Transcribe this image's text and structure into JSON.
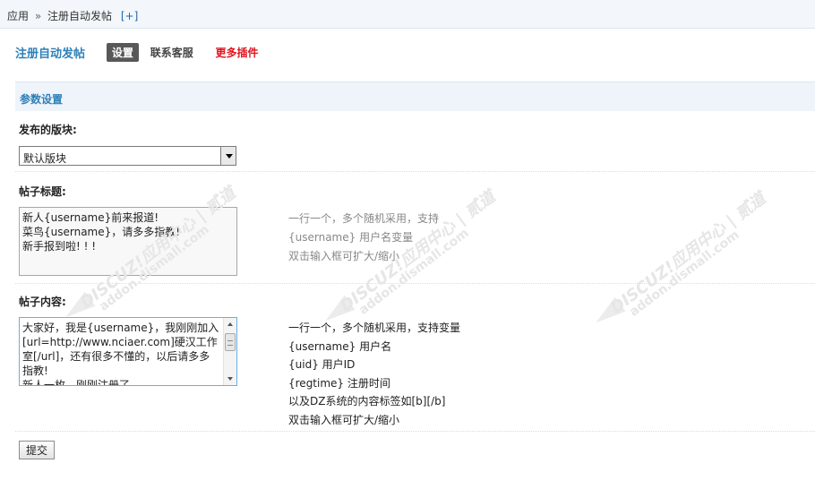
{
  "breadcrumb": {
    "app": "应用",
    "separator": "»",
    "current": "注册自动发帖",
    "add_label": "[+]"
  },
  "header": {
    "title": "注册自动发帖",
    "tabs": [
      {
        "label": "设置",
        "active": true
      },
      {
        "label": "联系客服",
        "active": false
      },
      {
        "label": "更多插件",
        "active": false,
        "color": "#e0141e"
      }
    ]
  },
  "section": {
    "title": "参数设置"
  },
  "form": {
    "forum": {
      "label": "发布的版块:",
      "selected": "默认版块"
    },
    "post_title": {
      "label": "帖子标题:",
      "lines": [
        "新人{username}前来报道!",
        "菜鸟{username}，请多多指教!",
        "新手报到啦! ! !"
      ],
      "tips": [
        "一行一个，多个随机采用，支持",
        "{username} 用户名变量",
        "双击输入框可扩大/缩小"
      ]
    },
    "post_content": {
      "label": "帖子内容:",
      "text": "大家好，我是{username}，我刚刚加入[url=http://www.nciaer.com]硬汉工作室[/url]，还有很多不懂的，以后请多多指教!",
      "text_line2": "新人一枚，刚刚注册了",
      "tips": [
        "一行一个，多个随机采用，支持变量",
        "{username} 用户名",
        "{uid} 用户ID",
        "{regtime} 注册时间",
        "以及DZ系统的内容标签如[b][/b]",
        "双击输入框可扩大/缩小"
      ]
    },
    "submit_label": "提交"
  },
  "watermark": {
    "brand": "DISCUZ!应用中心 | 贰道",
    "domain": "addon.dismall.com"
  },
  "colors": {
    "accent": "#2e80b8",
    "more_plugins": "#e0141e",
    "active_tab_bg": "#585858"
  }
}
